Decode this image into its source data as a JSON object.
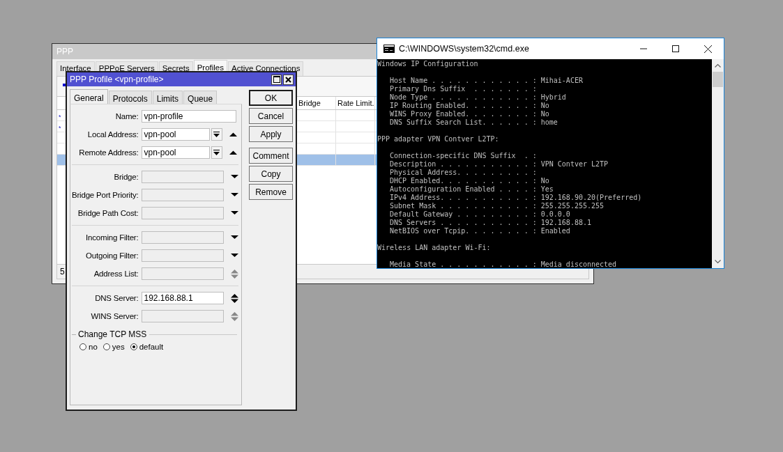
{
  "ppp_window": {
    "title": "PPP",
    "tabs": [
      {
        "label": "Interface",
        "selected": false
      },
      {
        "label": "PPPoE Servers",
        "selected": false
      },
      {
        "label": "Secrets",
        "selected": false
      },
      {
        "label": "Profiles",
        "selected": true
      },
      {
        "label": "Active Connections",
        "selected": false
      }
    ],
    "table": {
      "columns": [
        "Bridge",
        "Rate Limit."
      ],
      "rows": [
        {
          "flag": "*",
          "selected": false
        },
        {
          "flag": "*",
          "selected": false
        },
        {
          "selected": false
        },
        {
          "selected": false
        },
        {
          "selected": true
        }
      ]
    },
    "status": "5"
  },
  "profile_dialog": {
    "title": "PPP Profile <vpn-profile>",
    "tabs": [
      {
        "label": "General",
        "selected": true
      },
      {
        "label": "Protocols",
        "selected": false
      },
      {
        "label": "Limits",
        "selected": false
      },
      {
        "label": "Queue",
        "selected": false
      }
    ],
    "sections": [
      [
        {
          "kind": "text",
          "label": "Name:",
          "value": "vpn-profile"
        },
        {
          "kind": "pick",
          "label": "Local Address:",
          "value": "vpn-pool"
        },
        {
          "kind": "pick",
          "label": "Remote Address:",
          "value": "vpn-pool"
        }
      ],
      [
        {
          "kind": "dropdown",
          "label": "Bridge:"
        },
        {
          "kind": "dropdown",
          "label": "Bridge Port Priority:"
        },
        {
          "kind": "dropdown",
          "label": "Bridge Path Cost:"
        }
      ],
      [
        {
          "kind": "dropdown",
          "label": "Incoming Filter:"
        },
        {
          "kind": "dropdown",
          "label": "Outgoing Filter:"
        },
        {
          "kind": "updown",
          "label": "Address List:",
          "active": false
        }
      ],
      [
        {
          "kind": "updown",
          "label": "DNS Server:",
          "value": "192.168.88.1",
          "active": true
        },
        {
          "kind": "updown",
          "label": "WINS Server:",
          "active": false
        }
      ]
    ],
    "group": {
      "title": "Change TCP MSS",
      "options": [
        {
          "label": "no",
          "selected": false
        },
        {
          "label": "yes",
          "selected": false
        },
        {
          "label": "default",
          "selected": true
        }
      ]
    },
    "buttons": [
      [
        {
          "label": "OK",
          "default": true
        },
        {
          "label": "Cancel",
          "default": false
        },
        {
          "label": "Apply",
          "default": false
        }
      ],
      [
        {
          "label": "Comment",
          "default": false
        },
        {
          "label": "Copy",
          "default": false
        },
        {
          "label": "Remove",
          "default": false
        }
      ]
    ]
  },
  "cmd_window": {
    "title": "C:\\WINDOWS\\system32\\cmd.exe",
    "sections": [
      {
        "heading": "Windows IP Configuration",
        "lines": [
          "Host Name . . . . . . . . . . . . : Mihai-ACER",
          "Primary Dns Suffix  . . . . . . . :",
          "Node Type . . . . . . . . . . . . : Hybrid",
          "IP Routing Enabled. . . . . . . . : No",
          "WINS Proxy Enabled. . . . . . . . : No",
          "DNS Suffix Search List. . . . . . : home"
        ]
      },
      {
        "heading": "PPP adapter VPN Contver L2TP:",
        "lines": [
          "Connection-specific DNS Suffix  . :",
          "Description . . . . . . . . . . . : VPN Contver L2TP",
          "Physical Address. . . . . . . . . :",
          "DHCP Enabled. . . . . . . . . . . : No",
          "Autoconfiguration Enabled . . . . : Yes",
          "IPv4 Address. . . . . . . . . . . : 192.168.90.20(Preferred)",
          "Subnet Mask . . . . . . . . . . . : 255.255.255.255",
          "Default Gateway . . . . . . . . . : 0.0.0.0",
          "DNS Servers . . . . . . . . . . . : 192.168.88.1",
          "NetBIOS over Tcpip. . . . . . . . : Enabled"
        ]
      },
      {
        "heading": "Wireless LAN adapter Wi-Fi:",
        "lines": [
          "Media State . . . . . . . . . . . : Media disconnected"
        ]
      }
    ]
  }
}
